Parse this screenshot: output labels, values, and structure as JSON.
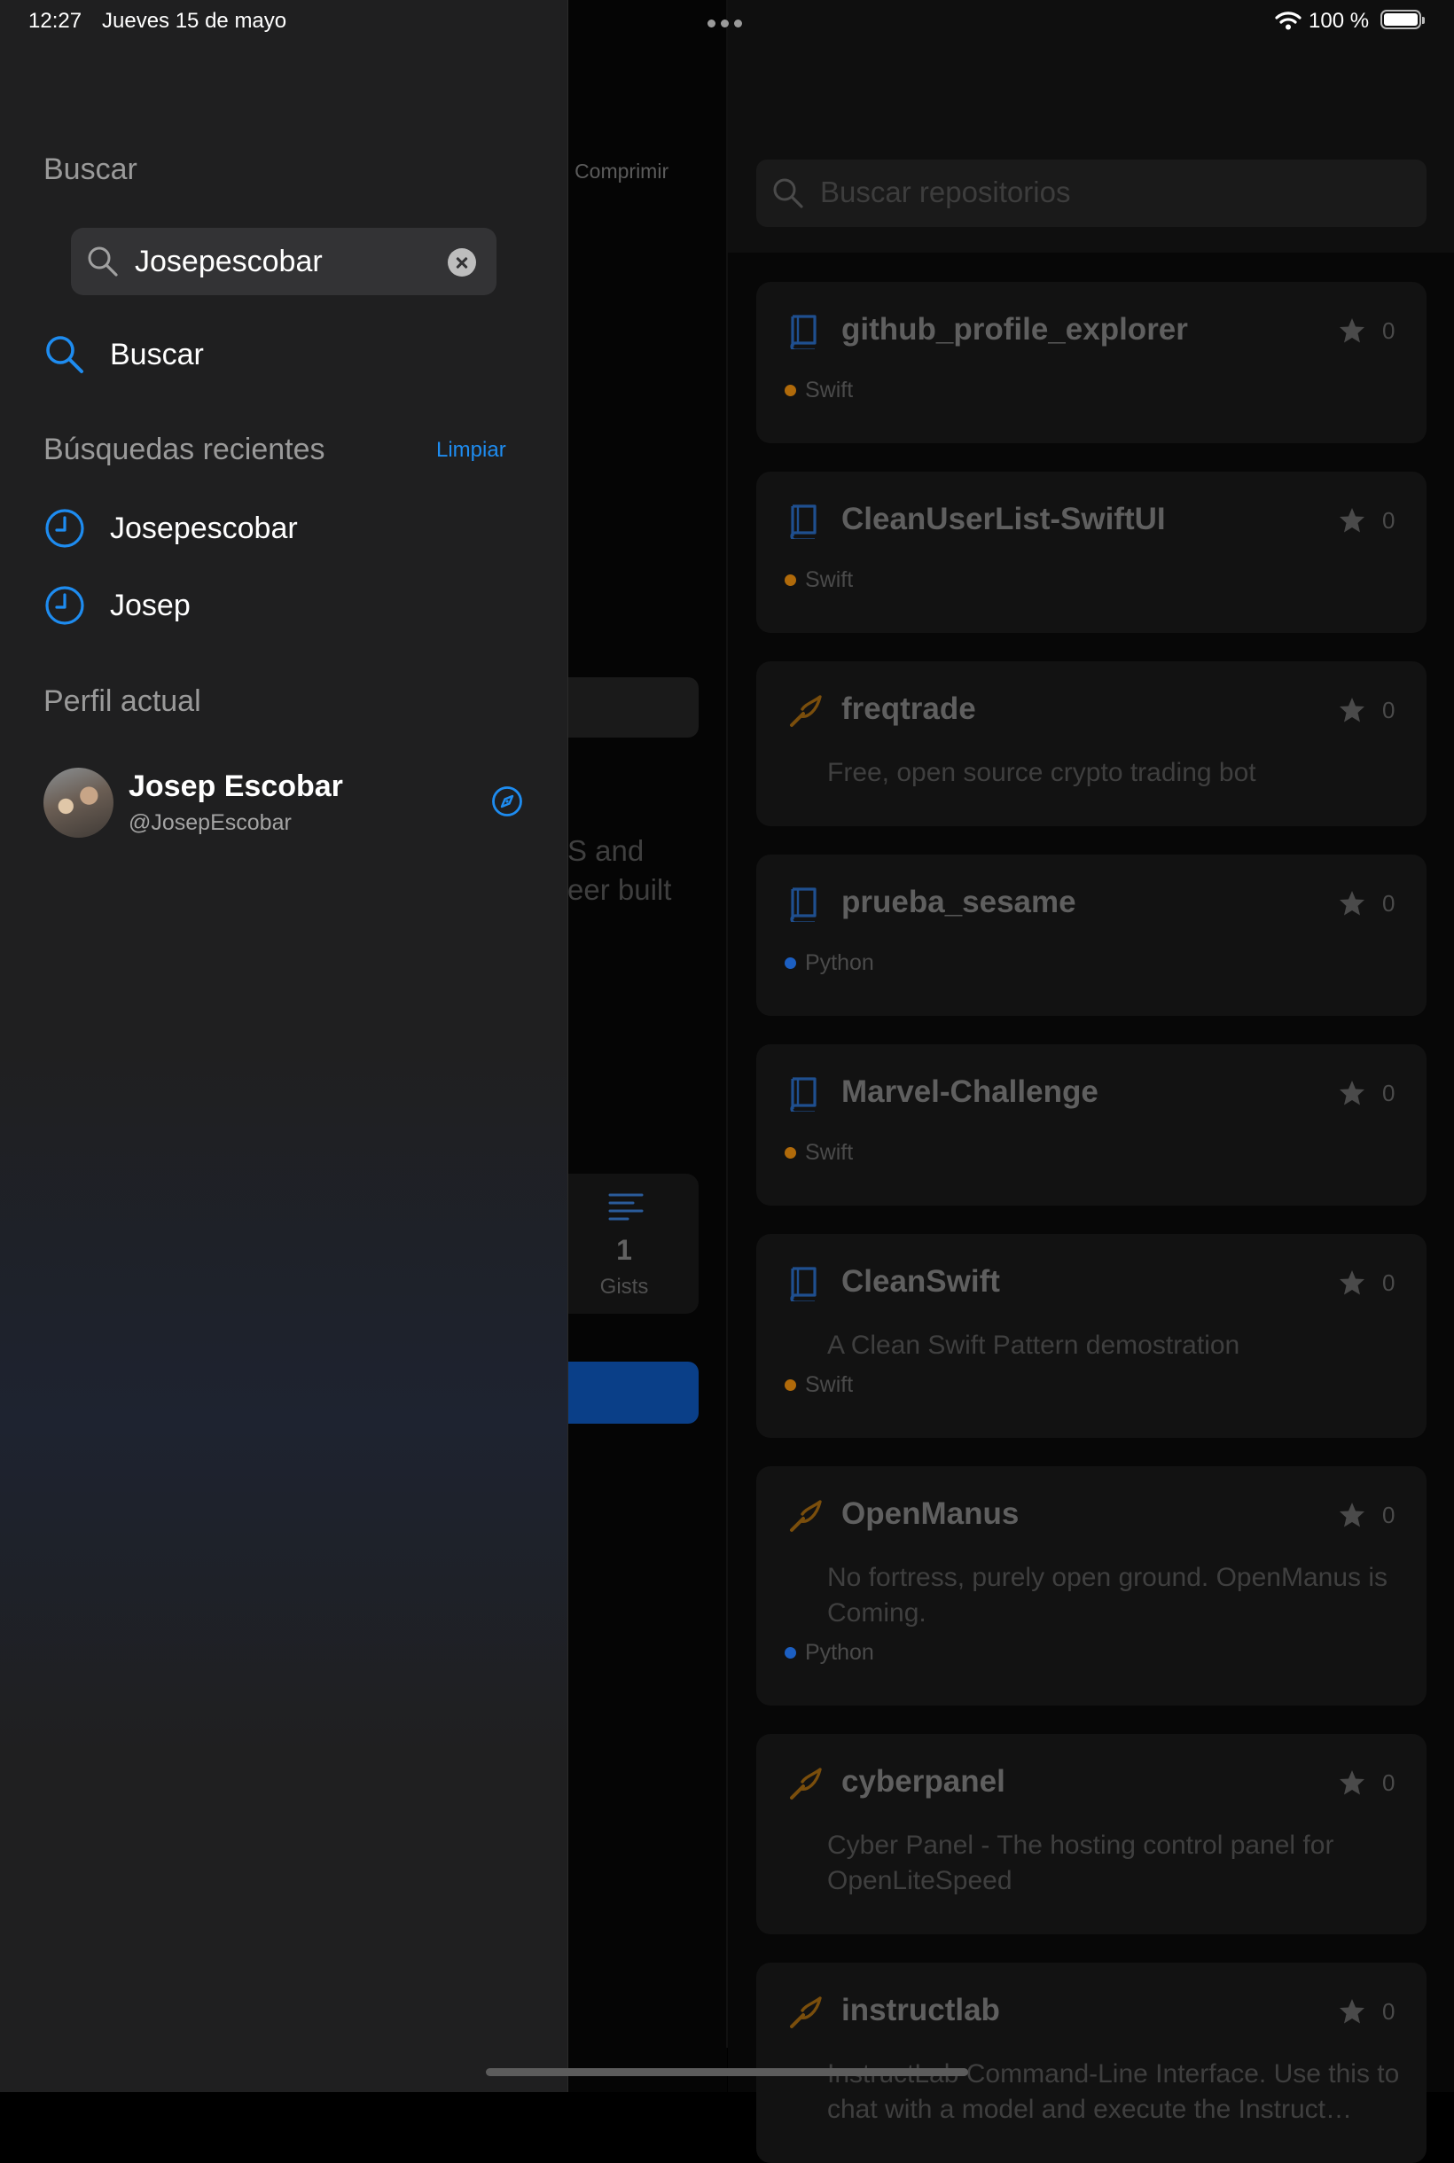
{
  "status_bar": {
    "time": "12:27",
    "date": "Jueves 15 de mayo",
    "battery": "100 %",
    "icons": [
      "multitasking-dots-icon",
      "wifi-icon",
      "battery-icon"
    ]
  },
  "sidebar": {
    "search_title": "Buscar",
    "search_value": "Josepescobar",
    "search_action": "Buscar",
    "recent_title": "Búsquedas recientes",
    "clear_label": "Limpiar",
    "recent": [
      {
        "label": "Josepescobar"
      },
      {
        "label": "Josep"
      }
    ],
    "current_profile_title": "Perfil actual",
    "profile": {
      "name": "Josep Escobar",
      "handle": "@JosepEscobar"
    }
  },
  "detail": {
    "collapse_label": "Comprimir",
    "bio_fragment_1": "S and",
    "bio_fragment_2": "eer built",
    "gists_count": "1",
    "gists_label": "Gists"
  },
  "repos": {
    "search_placeholder": "Buscar repositorios",
    "lang_colors": {
      "Swift": "#b06a0a",
      "Python": "#1c5fc2"
    },
    "items": [
      {
        "name": "github_profile_explorer",
        "stars": "0",
        "type": "repo",
        "description": "",
        "language": "Swift"
      },
      {
        "name": "CleanUserList-SwiftUI",
        "stars": "0",
        "type": "repo",
        "description": "",
        "language": "Swift"
      },
      {
        "name": "freqtrade",
        "stars": "0",
        "type": "fork",
        "description": "Free, open source crypto trading bot",
        "language": ""
      },
      {
        "name": "prueba_sesame",
        "stars": "0",
        "type": "repo",
        "description": "",
        "language": "Python"
      },
      {
        "name": "Marvel-Challenge",
        "stars": "0",
        "type": "repo",
        "description": "",
        "language": "Swift"
      },
      {
        "name": "CleanSwift",
        "stars": "0",
        "type": "repo",
        "description": "A Clean Swift Pattern demostration",
        "language": "Swift"
      },
      {
        "name": "OpenManus",
        "stars": "0",
        "type": "fork",
        "description": "No fortress, purely open ground.  OpenManus is Coming.",
        "language": "Python"
      },
      {
        "name": "cyberpanel",
        "stars": "0",
        "type": "fork",
        "description": "Cyber Panel - The hosting control panel for OpenLiteSpeed",
        "language": ""
      },
      {
        "name": "instructlab",
        "stars": "0",
        "type": "fork",
        "description": "InstructLab Command-Line Interface.  Use this to chat with a model and execute the Instruct…",
        "language": ""
      }
    ]
  }
}
